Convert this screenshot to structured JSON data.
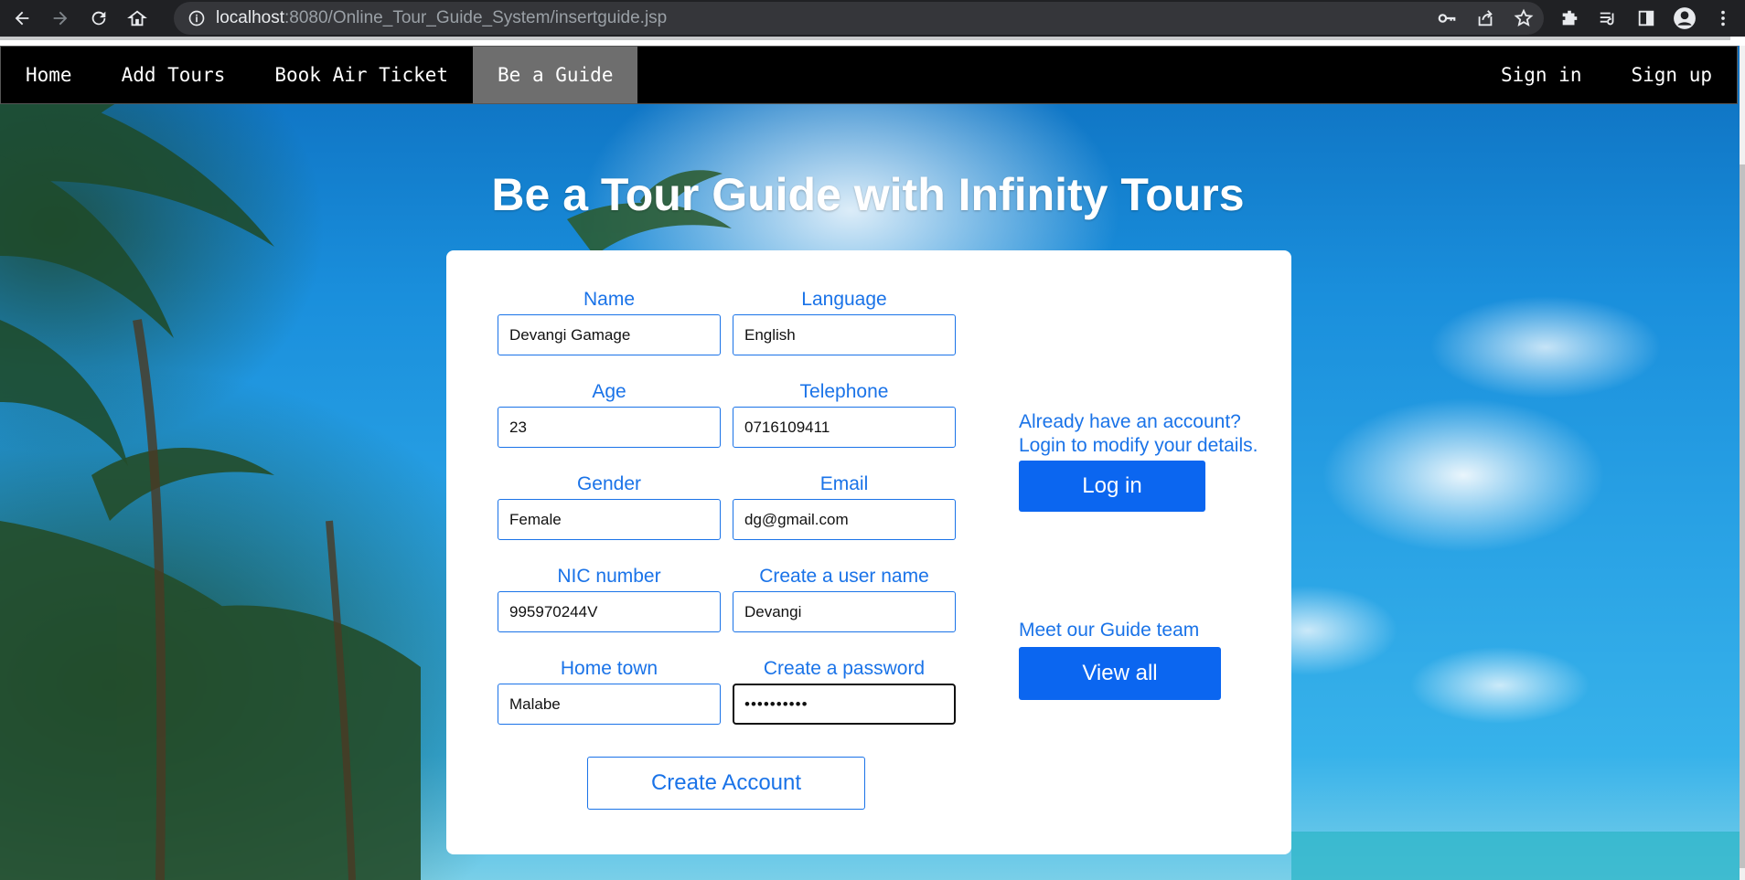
{
  "browser": {
    "url_host": "localhost",
    "url_path": ":8080/Online_Tour_Guide_System/insertguide.jsp"
  },
  "nav": {
    "items": [
      {
        "label": "Home"
      },
      {
        "label": "Add Tours"
      },
      {
        "label": "Book Air Ticket"
      },
      {
        "label": "Be a Guide",
        "active": true
      }
    ],
    "right_items": [
      {
        "label": "Sign in"
      },
      {
        "label": "Sign up"
      }
    ]
  },
  "page": {
    "title": "Be a Tour Guide with Infinity Tours"
  },
  "form": {
    "name": {
      "label": "Name",
      "value": "Devangi Gamage"
    },
    "language": {
      "label": "Language",
      "value": "English"
    },
    "age": {
      "label": "Age",
      "value": "23"
    },
    "telephone": {
      "label": "Telephone",
      "value": "0716109411"
    },
    "gender": {
      "label": "Gender",
      "value": "Female"
    },
    "email": {
      "label": "Email",
      "value": "dg@gmail.com"
    },
    "nic": {
      "label": "NIC number",
      "value": "995970244V"
    },
    "username": {
      "label": "Create a user name",
      "value": "Devangi"
    },
    "hometown": {
      "label": "Home town",
      "value": "Malabe"
    },
    "password": {
      "label": "Create a password",
      "value": "••••••••••"
    },
    "submit_label": "Create Account"
  },
  "side": {
    "login_prompt_line1": "Already have an account?",
    "login_prompt_line2": "Login to modify your details.",
    "login_button": "Log in",
    "team_prompt": "Meet our Guide team",
    "team_button": "View all"
  },
  "colors": {
    "accent": "#1a73e8",
    "button_fill": "#0b66f0",
    "nav_bg": "#000000",
    "nav_active": "#6e6e6e"
  }
}
